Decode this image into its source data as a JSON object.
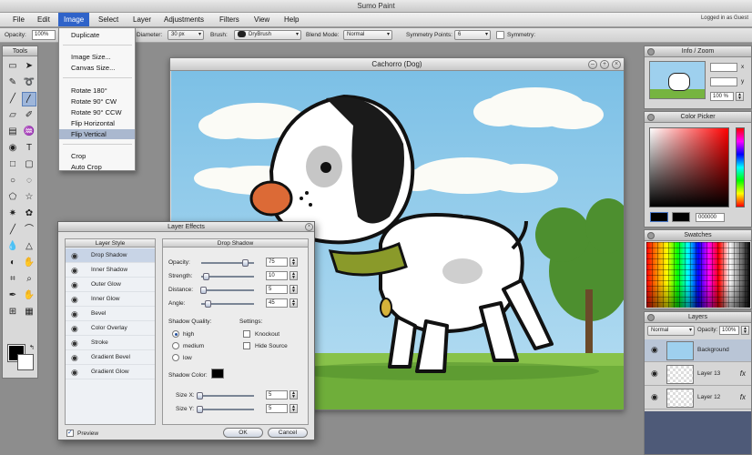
{
  "window": {
    "title": "Sumo Paint"
  },
  "menubar": {
    "items": [
      "File",
      "Edit",
      "Image",
      "Select",
      "Layer",
      "Adjustments",
      "Filters",
      "View",
      "Help"
    ],
    "logged_in": "Logged in as Guest"
  },
  "toolbar": {
    "opacity_label": "Opacity:",
    "opacity_value": "100%",
    "diameter_label": "Diameter:",
    "diameter_value": "30 px",
    "brush_label": "Brush:",
    "brush_value": "DryBrush",
    "blend_label": "Blend Mode:",
    "blend_value": "Normal",
    "symmetry_points_label": "Symmetry Points:",
    "symmetry_points_value": "6",
    "symmetry_label": "Symmetry:"
  },
  "tools_panel": {
    "title": "Tools"
  },
  "image_menu": {
    "items": [
      "Duplicate",
      "Image Size...",
      "Canvas Size...",
      "Rotate 180°",
      "Rotate 90° CW",
      "Rotate 90° CCW",
      "Flip Horizontal",
      "Flip Vertical",
      "Crop",
      "Auto Crop"
    ],
    "highlighted": "Flip Vertical"
  },
  "canvas_window": {
    "title": "Cachorro (Dog)"
  },
  "layer_effects": {
    "title": "Layer Effects",
    "style_header": "Layer Style",
    "styles": [
      "Drop Shadow",
      "Inner Shadow",
      "Outer Glow",
      "Inner Glow",
      "Bevel",
      "Color Overlay",
      "Stroke",
      "Gradient Bevel",
      "Gradient Glow"
    ],
    "selected_style": "Drop Shadow",
    "panel_header": "Drop Shadow",
    "opacity_label": "Opacity:",
    "opacity_value": "75",
    "strength_label": "Strength:",
    "strength_value": "10",
    "distance_label": "Distance:",
    "distance_value": "5",
    "angle_label": "Angle:",
    "angle_value": "45",
    "quality_label": "Shadow Quality:",
    "quality_options": [
      "high",
      "medium",
      "low"
    ],
    "quality_selected": "high",
    "settings_label": "Settings:",
    "settings_options": [
      "Knockout",
      "Hide Source"
    ],
    "shadow_color_label": "Shadow Color:",
    "shadow_color": "#000000",
    "sizex_label": "Size X:",
    "sizex_value": "5",
    "sizey_label": "Size Y:",
    "sizey_value": "5",
    "preview_label": "Preview",
    "ok_label": "OK",
    "cancel_label": "Cancel"
  },
  "info_zoom": {
    "title": "Info / Zoom",
    "x_label": "x",
    "y_label": "y",
    "zoom_value": "100 %"
  },
  "color_picker": {
    "title": "Color Picker",
    "hex_value": "000000"
  },
  "swatches": {
    "title": "Swatches"
  },
  "layers": {
    "title": "Layers",
    "blend_value": "Normal",
    "opacity_label": "Opacity:",
    "opacity_value": "100%",
    "items": [
      {
        "name": "Background",
        "fx": ""
      },
      {
        "name": "Layer 13",
        "fx": "fx"
      },
      {
        "name": "Layer 12",
        "fx": "fx"
      }
    ]
  },
  "colors": {
    "menu_highlight": "#2f63c9",
    "selection": "#aab8cf"
  }
}
